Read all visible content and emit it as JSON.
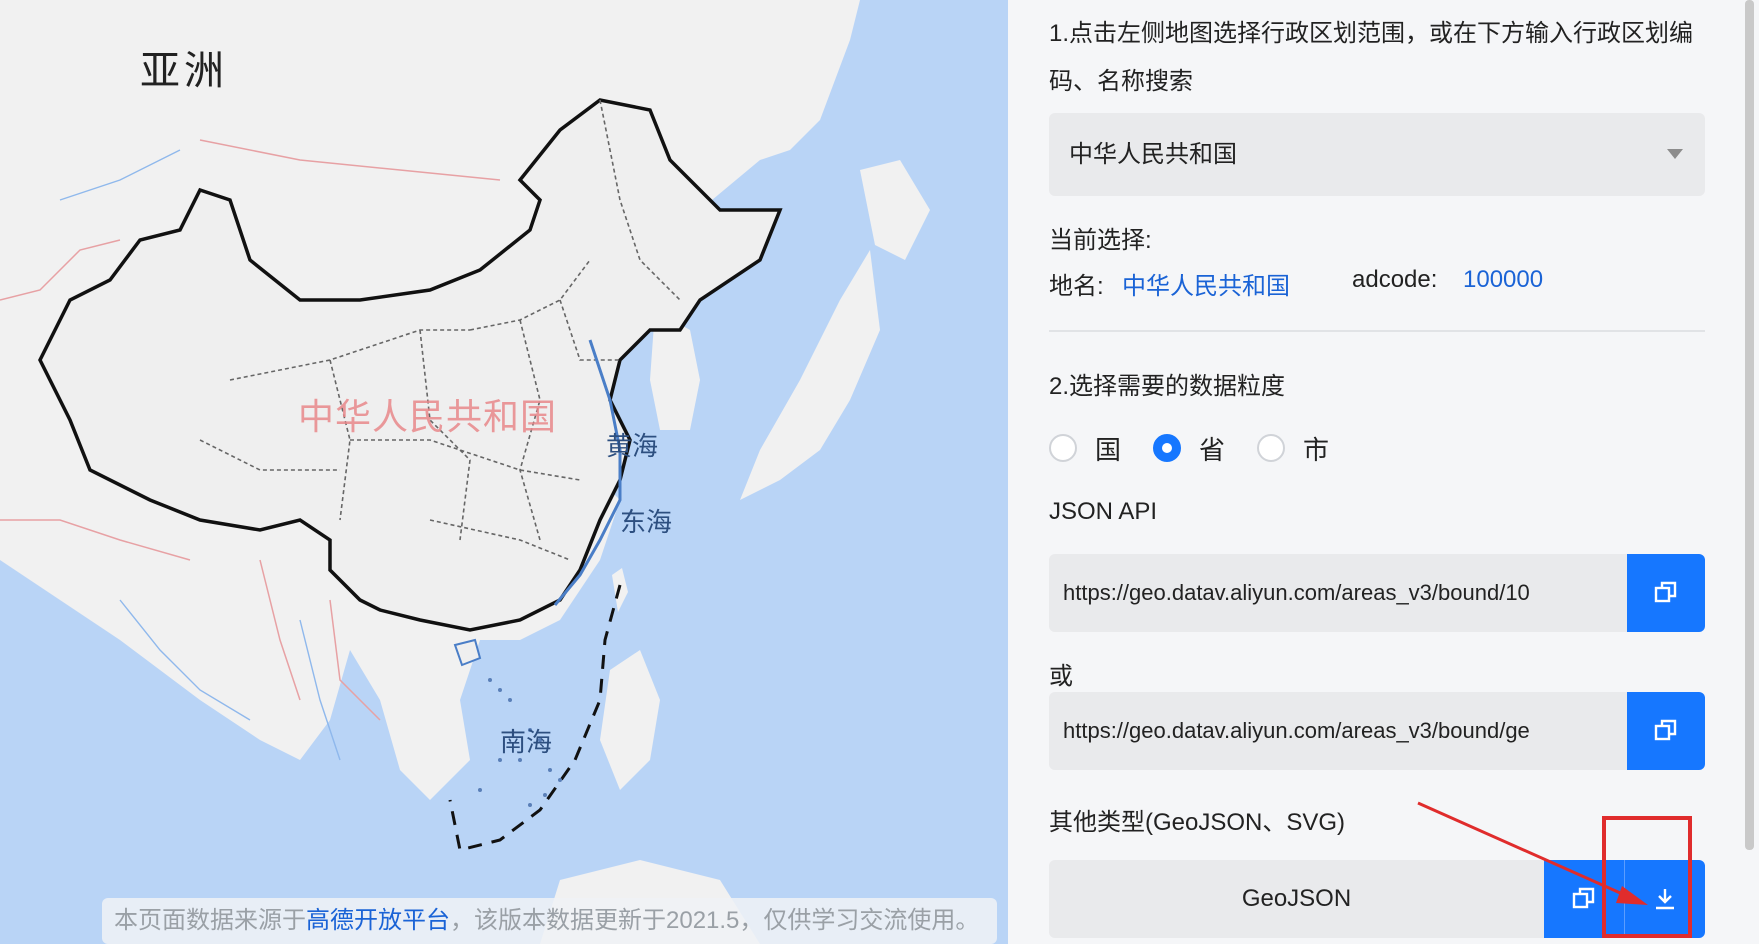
{
  "map": {
    "continent_label": "亚洲",
    "country_label": "中华人民共和国",
    "sea_labels": [
      "黄海",
      "东海",
      "南海"
    ],
    "footer": {
      "prefix": "本页面数据来源于",
      "link": "高德开放平台",
      "suffix": "，该版本数据更新于2021.5，仅供学习交流使用。"
    },
    "colors": {
      "sea": "#b9d4f6",
      "land": "#f2f2f2",
      "border": "#111111",
      "accent": "#1677ff"
    }
  },
  "panel": {
    "step1": "1.点击左侧地图选择行政区划范围，或在下方输入行政区划编码、名称搜索",
    "select_value": "中华人民共和国",
    "current_selection_label": "当前选择:",
    "name_label": "地名:",
    "name_value": "中华人民共和国",
    "adcode_label": "adcode:",
    "adcode_value": "100000",
    "step2": "2.选择需要的数据粒度",
    "granularity": [
      {
        "label": "国",
        "checked": false
      },
      {
        "label": "省",
        "checked": true
      },
      {
        "label": "市",
        "checked": false
      }
    ],
    "json_api_label": "JSON API",
    "url1": "https://geo.datav.aliyun.com/areas_v3/bound/10",
    "or_label": "或",
    "url2": "https://geo.datav.aliyun.com/areas_v3/bound/ge",
    "other_types_label": "其他类型(GeoJSON、SVG)",
    "geojson_label": "GeoJSON",
    "icons": {
      "copy": "copy-icon",
      "download": "download-icon",
      "caret": "caret-down-icon"
    }
  }
}
